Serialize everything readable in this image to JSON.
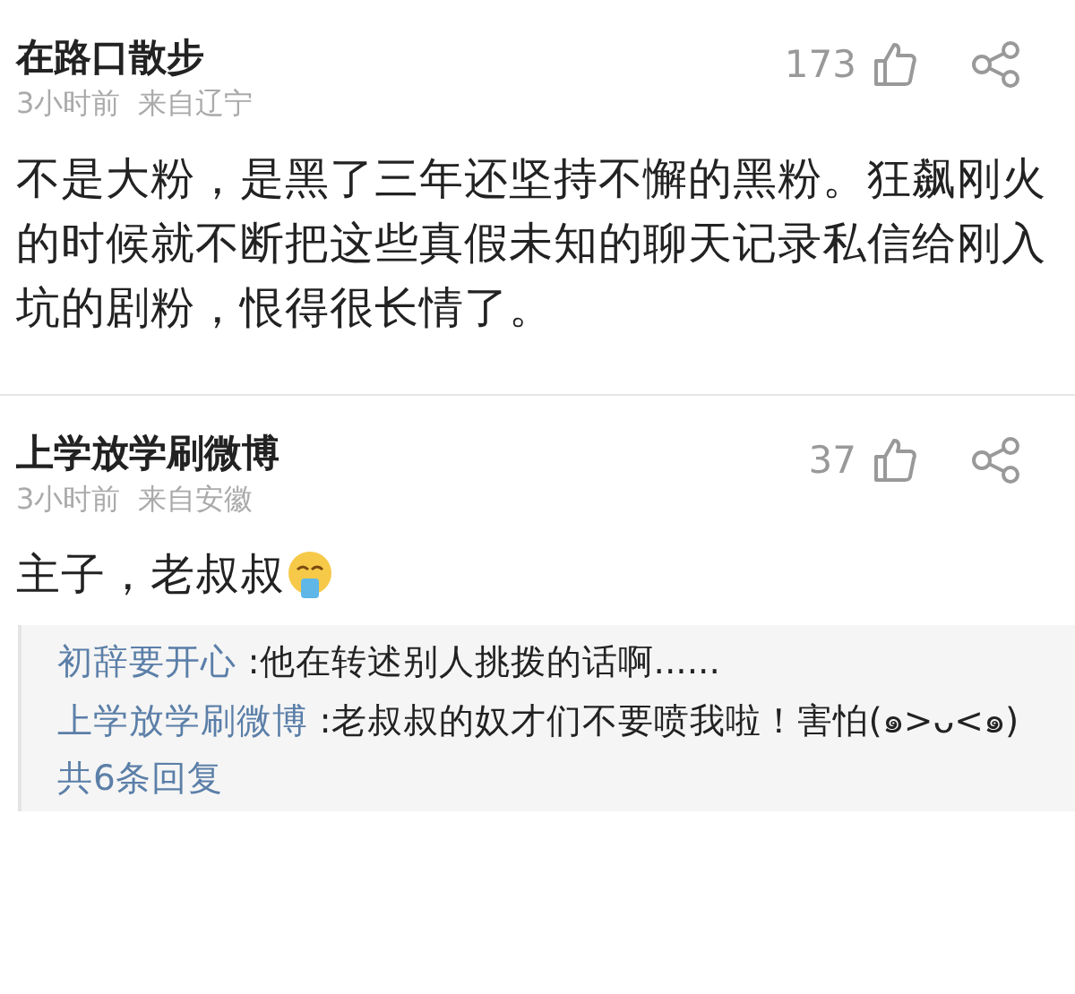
{
  "comments": [
    {
      "author": "在路口散步",
      "time": "3小时前",
      "location": "来自辽宁",
      "likes": "173",
      "body": "不是大粉，是黑了三年还坚持不懈的黑粉。狂飙刚火的时候就不断把这些真假未知的聊天记录私信给刚入坑的剧粉，恨得很长情了。",
      "emoji": false
    },
    {
      "author": "上学放学刷微博",
      "time": "3小时前",
      "location": "来自安徽",
      "likes": "37",
      "body": "主子，老叔叔",
      "emoji": true,
      "replies": [
        {
          "author": "初辞要开心",
          "text": ":他在转述别人挑拨的话啊......"
        },
        {
          "author": "上学放学刷微博",
          "text": ":老叔叔的奴才们不要喷我啦！害怕(๑>ᴗ<๑)"
        }
      ],
      "reply_count": "共6条回复"
    }
  ]
}
